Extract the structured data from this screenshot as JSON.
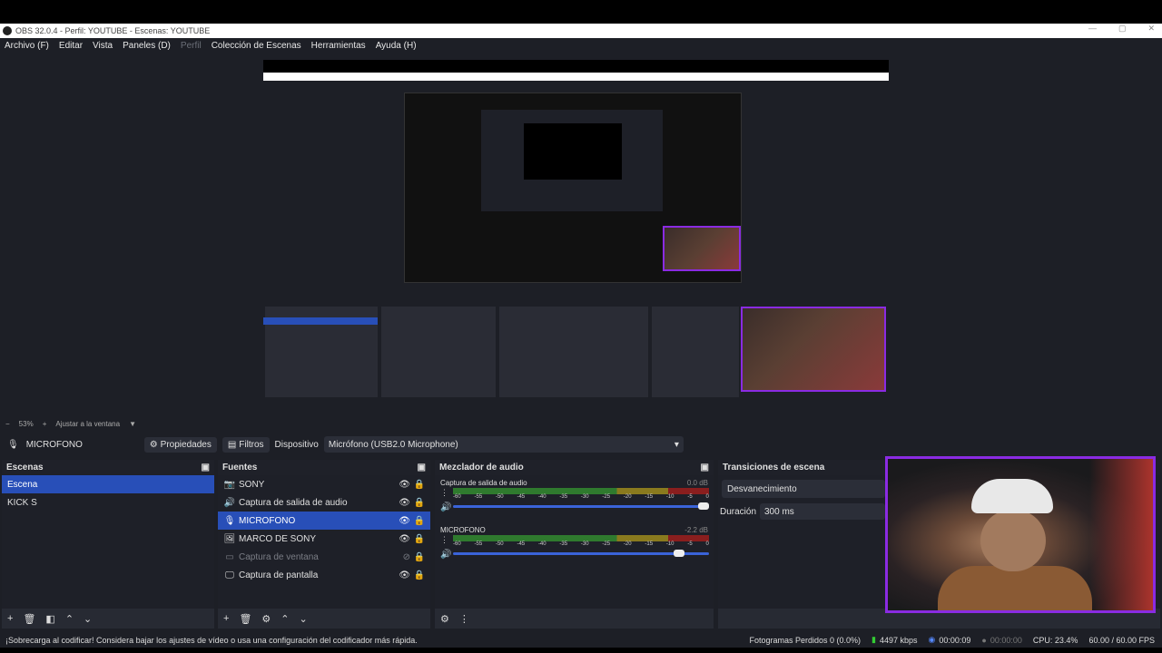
{
  "window": {
    "title": "OBS 32.0.4 - Perfil: YOUTUBE - Escenas: YOUTUBE",
    "minimize": "—",
    "maximize": "▢",
    "close": "✕"
  },
  "menu": {
    "archivo": "Archivo (F)",
    "editar": "Editar",
    "vista": "Vista",
    "paneles": "Paneles (D)",
    "perfil": "Perfil",
    "coleccion": "Colección de Escenas",
    "herramientas": "Herramientas",
    "ayuda": "Ayuda (H)"
  },
  "zoom": {
    "minus": "−",
    "value": "53%",
    "plus": "+",
    "fit": "Ajustar a la ventana"
  },
  "source_toolbar": {
    "selected_source": "MICROFONO",
    "properties": "Propiedades",
    "filters": "Filtros",
    "device_label": "Dispositivo",
    "device_value": "Micrófono (USB2.0 Microphone)"
  },
  "scenes": {
    "title": "Escenas",
    "items": [
      "Escena",
      "KICK S"
    ],
    "selected": 0
  },
  "sources": {
    "title": "Fuentes",
    "items": [
      {
        "label": "SONY",
        "icon": "camera-icon",
        "dim": false,
        "sel": false
      },
      {
        "label": "Captura de salida de audio",
        "icon": "speaker-icon",
        "dim": false,
        "sel": false
      },
      {
        "label": "MICROFONO",
        "icon": "mic-icon",
        "dim": false,
        "sel": true
      },
      {
        "label": "MARCO DE SONY",
        "icon": "image-icon",
        "dim": false,
        "sel": false
      },
      {
        "label": "Captura de ventana",
        "icon": "window-icon",
        "dim": true,
        "sel": false
      },
      {
        "label": "Captura de pantalla",
        "icon": "monitor-icon",
        "dim": false,
        "sel": false
      }
    ]
  },
  "mixer": {
    "title": "Mezclador de audio",
    "ticks": [
      "-60",
      "-55",
      "-50",
      "-45",
      "-40",
      "-35",
      "-30",
      "-25",
      "-20",
      "-15",
      "-10",
      "-5",
      "0"
    ],
    "channels": [
      {
        "name": "Captura de salida de audio",
        "db": "0.0 dB",
        "volume": 1.0
      },
      {
        "name": "MICROFONO",
        "db": "-2.2 dB",
        "volume": 0.9
      }
    ]
  },
  "transitions": {
    "title": "Transiciones de escena",
    "type": "Desvanecimiento",
    "duration_label": "Duración",
    "duration_value": "300 ms"
  },
  "status": {
    "warning": "¡Sobrecarga al codificar! Considera bajar los ajustes de vídeo o usa una configuración del codificador más rápida.",
    "frames": "Fotogramas Perdidos 0 (0.0%)",
    "bitrate": "4497 kbps",
    "stream_time": "00:00:09",
    "rec_time": "00:00:00",
    "cpu": "CPU: 23.4%",
    "fps": "60.00 / 60.00 FPS"
  },
  "colors": {
    "accent": "#284fb8",
    "frame": "#8a2be2",
    "bg": "#1d1f26"
  }
}
